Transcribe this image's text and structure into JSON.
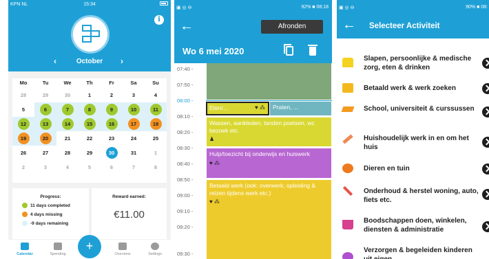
{
  "panel1": {
    "status": {
      "carrier": "KPN NL",
      "time": "15:34"
    },
    "info_label": "i",
    "month": "October",
    "prev": "‹",
    "next": "›",
    "weekdays": [
      "Mo",
      "Tu",
      "We",
      "Th",
      "Fr",
      "Sa",
      "Su"
    ],
    "days": [
      [
        "28",
        "29",
        "30",
        "1",
        "2",
        "3",
        "4"
      ],
      [
        "5",
        "6",
        "7",
        "8",
        "9",
        "10",
        "11"
      ],
      [
        "12",
        "13",
        "14",
        "15",
        "16",
        "17",
        "18"
      ],
      [
        "19",
        "20",
        "21",
        "22",
        "23",
        "24",
        "25"
      ],
      [
        "26",
        "27",
        "28",
        "29",
        "30",
        "31",
        "1"
      ],
      [
        "2",
        "3",
        "4",
        "5",
        "6",
        "7",
        "8"
      ]
    ],
    "progress": {
      "title": "Progress:",
      "completed": "11 days completed",
      "missing": "4 days missing",
      "remaining": "-9 days remaining"
    },
    "reward": {
      "title": "Reward earned:",
      "amount": "€11.00"
    },
    "tabs": [
      "Calendar",
      "Spending",
      "Overview",
      "Settings"
    ],
    "fab": "+",
    "colors": {
      "primary": "#1ea0d6",
      "completed": "#9fc92e",
      "missing": "#f29120",
      "remaining": "#def1f8"
    }
  },
  "panel2": {
    "status": {
      "right": "92% ■ 08:18"
    },
    "finish_button": "Afronden",
    "date": "Wo 6 mei 2020",
    "times": [
      "07:40 -",
      "07:50 -",
      "08:00 -",
      "08:10 -",
      "08:20 -",
      "08:30 -",
      "08:40 -",
      "08:50 -",
      "09:00 -",
      "09:10 -",
      "09:20 -",
      "09:30 -"
    ],
    "blocks": [
      {
        "text": "",
        "color": "#7fa779"
      },
      {
        "text": "Eten/...",
        "color": "#d9d832"
      },
      {
        "text": "Praten, ...",
        "color": "#70b6c0"
      },
      {
        "text": "Wassen, aankleden, tanden poetsen, wc bezoek etc.",
        "color": "#d9d832"
      },
      {
        "text": "Hulp/toezicht bij onderwijs en huiswerk",
        "color": "#b866d1"
      },
      {
        "text": "Betaald werk (ook: overwerk, opleiding & reizen tijdens werk etc.)",
        "color": "#eecb2c"
      }
    ]
  },
  "panel3": {
    "status": {
      "right": "90% ■ 08:"
    },
    "title": "Selecteer Activiteit",
    "activities": [
      "Slapen, persoonlijke & medische zorg, eten & drinken",
      "Betaald werk & werk zoeken",
      "School,  universiteit & curssussen",
      "Huishoudelijk werk in en om het huis",
      "Dieren en tuin",
      "Onderhoud & herstel woning, auto, fiets etc.",
      "Boodschappen doen, winkelen, diensten & administratie",
      "Verzorgen & begeleiden kinderen uit eigen"
    ]
  }
}
